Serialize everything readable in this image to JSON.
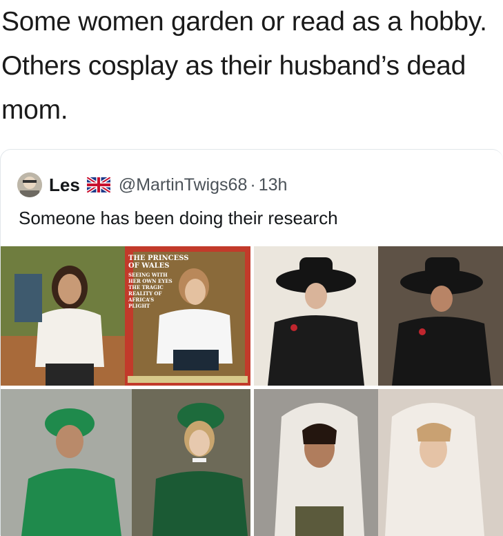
{
  "post": {
    "caption": "Some women garden or read as a hobby. Others cosplay as their husband’s dead mom."
  },
  "tweet": {
    "display_name": "Les",
    "flag_icon": "uk-flag-icon",
    "handle": "@MartinTwigs68",
    "separator": "·",
    "time": "13h",
    "text": "Someone has been doing their research"
  },
  "magazine": {
    "title_line1": "THE PRINCESS",
    "title_line2": "OF WALES",
    "body_lines": [
      "SEEING WITH",
      "HER OWN EYES",
      "THE TRAGIC",
      "REALITY OF",
      "AFRICA’S",
      "PLIGHT"
    ]
  },
  "colors": {
    "text": "#1a1a1a",
    "secondary_text": "#4b5258",
    "card_border": "#e1e6ea",
    "green_outfit": "#1f8a4c",
    "black_hat": "#141414"
  }
}
